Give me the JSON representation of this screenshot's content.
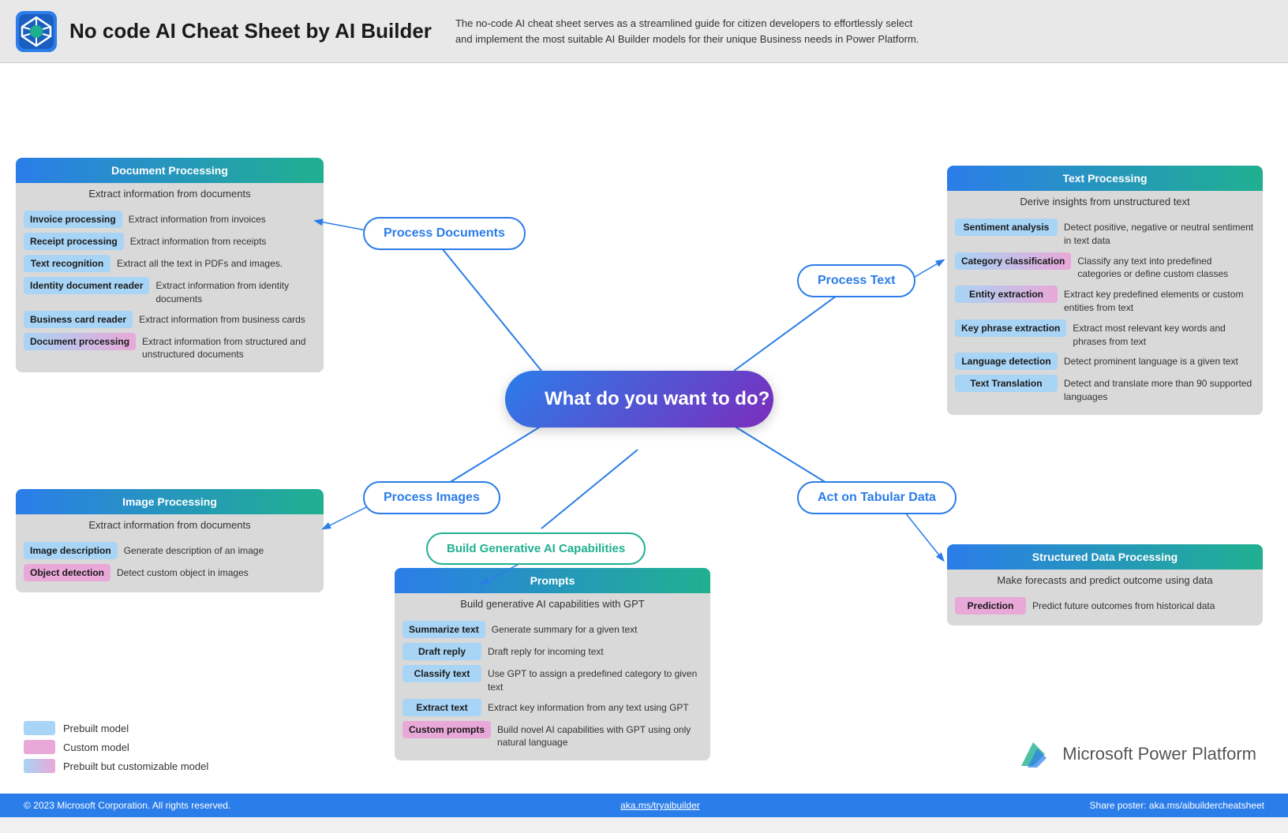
{
  "header": {
    "title": "No code AI Cheat Sheet by AI Builder",
    "description": "The no-code AI cheat sheet serves as a streamlined guide for citizen developers to effortlessly select and implement the most suitable AI Builder models for their unique Business needs in Power Platform."
  },
  "hub": {
    "label": "What do you want to do?"
  },
  "ovals": {
    "process_documents": "Process Documents",
    "process_text": "Process Text",
    "process_images": "Process Images",
    "act_tabular": "Act on Tabular Data",
    "build_gen_ai": "Build Generative AI Capabilities"
  },
  "document_processing": {
    "title": "Document Processing",
    "subtitle": "Extract information from documents",
    "items": [
      {
        "label": "Invoice processing",
        "desc": "Extract information from invoices",
        "color": "blue"
      },
      {
        "label": "Receipt processing",
        "desc": "Extract information from receipts",
        "color": "blue"
      },
      {
        "label": "Text  recognition",
        "desc": "Extract all the text in PDFs and images.",
        "color": "blue"
      },
      {
        "label": "Identity document reader",
        "desc": "Extract information from identity documents",
        "color": "blue"
      },
      {
        "label": "Business card reader",
        "desc": "Extract information from business cards",
        "color": "blue"
      },
      {
        "label": "Document processing",
        "desc": "Extract information from structured and unstructured documents",
        "color": "gradient"
      }
    ]
  },
  "image_processing": {
    "title": "Image Processing",
    "subtitle": "Extract information from documents",
    "items": [
      {
        "label": "Image description",
        "desc": "Generate description of an image",
        "color": "blue"
      },
      {
        "label": "Object detection",
        "desc": "Detect custom object in images",
        "color": "pink"
      }
    ]
  },
  "text_processing": {
    "title": "Text Processing",
    "subtitle": "Derive insights from unstructured text",
    "items": [
      {
        "label": "Sentiment analysis",
        "desc": "Detect positive, negative or neutral sentiment in text data",
        "color": "blue"
      },
      {
        "label": "Category classification",
        "desc": "Classify any text into predefined categories or define custom classes",
        "color": "gradient"
      },
      {
        "label": "Entity extraction",
        "desc": "Extract key predefined elements or custom entities from text",
        "color": "gradient"
      },
      {
        "label": "Key phrase extraction",
        "desc": "Extract most relevant key words and phrases from text",
        "color": "blue"
      },
      {
        "label": "Language detection",
        "desc": "Detect prominent language is a given text",
        "color": "blue"
      },
      {
        "label": "Text Translation",
        "desc": "Detect and translate more than 90 supported languages",
        "color": "blue"
      }
    ]
  },
  "structured_data": {
    "title": "Structured Data Processing",
    "subtitle": "Make forecasts and predict outcome using data",
    "items": [
      {
        "label": "Prediction",
        "desc": "Predict future outcomes from historical data",
        "color": "pink"
      }
    ]
  },
  "prompts": {
    "title": "Prompts",
    "subtitle": "Build generative AI capabilities with GPT",
    "items": [
      {
        "label": "Summarize text",
        "desc": "Generate summary for a given text",
        "color": "blue"
      },
      {
        "label": "Draft reply",
        "desc": "Draft reply for incoming text",
        "color": "blue"
      },
      {
        "label": "Classify text",
        "desc": "Use GPT to assign a predefined category to given text",
        "color": "blue"
      },
      {
        "label": "Extract text",
        "desc": "Extract key information from any text using GPT",
        "color": "blue"
      },
      {
        "label": "Custom prompts",
        "desc": "Build novel AI capabilities with GPT using only natural language",
        "color": "pink"
      }
    ]
  },
  "legend": {
    "items": [
      {
        "label": "Prebuilt model",
        "color": "blue"
      },
      {
        "label": "Custom model",
        "color": "pink"
      },
      {
        "label": "Prebuilt but customizable model",
        "color": "gradient"
      }
    ]
  },
  "footer": {
    "copyright": "© 2023 Microsoft Corporation. All rights reserved.",
    "link": "aka.ms/tryaibuilder",
    "share": "Share poster: aka.ms/aibuildercheatsheet"
  },
  "pp": {
    "label": "Microsoft Power Platform"
  }
}
